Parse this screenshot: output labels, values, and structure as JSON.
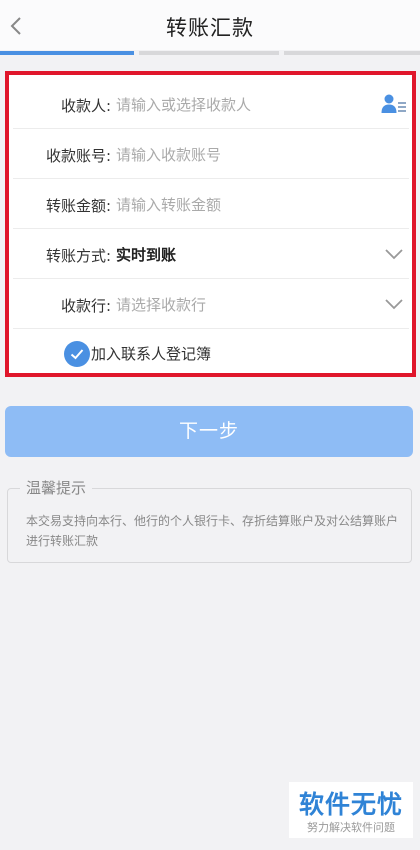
{
  "header": {
    "title": "转账汇款",
    "back_icon": "chevron-left-icon"
  },
  "steps": {
    "active_step": 1,
    "total_steps": 3,
    "active_color": "#4a90e2"
  },
  "form": {
    "payee": {
      "label": "收款人:",
      "placeholder": "请输入或选择收款人",
      "icon": "contact-list-icon"
    },
    "account": {
      "label": "收款账号:",
      "placeholder": "请输入收款账号"
    },
    "amount": {
      "label": "转账金额:",
      "placeholder": "请输入转账金额"
    },
    "method": {
      "label": "转账方式:",
      "value": "实时到账",
      "icon": "chevron-down-icon"
    },
    "bank": {
      "label": "收款行:",
      "placeholder": "请选择收款行",
      "icon": "chevron-down-icon"
    },
    "add_contact": {
      "label": "加入联系人登记簿",
      "checked": true
    }
  },
  "next_button": {
    "label": "下一步"
  },
  "tips": {
    "title": "温馨提示",
    "text": "本交易支持向本行、他行的个人银行卡、存折结算账户及对公结算账户进行转账汇款"
  },
  "watermark": {
    "title": "软件无忧",
    "subtitle": "努力解决软件问题"
  },
  "colors": {
    "accent": "#4a90e2",
    "highlight_border": "#e0162b",
    "button_bg": "#8ebcf5"
  }
}
